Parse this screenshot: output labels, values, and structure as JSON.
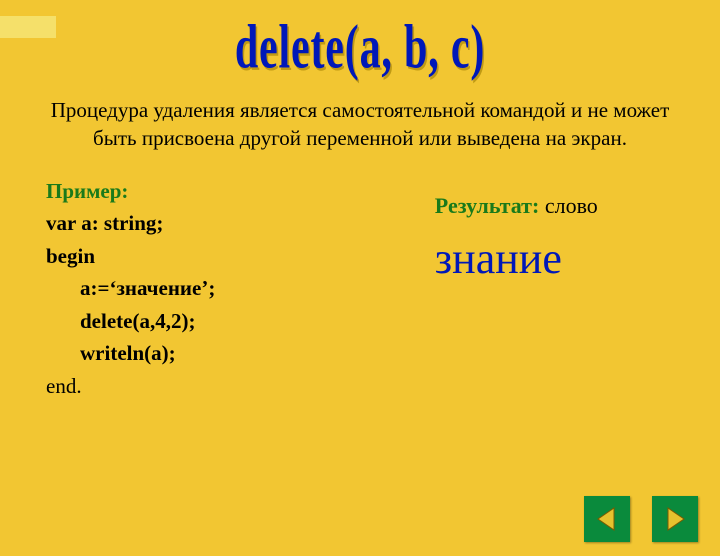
{
  "title": "delete(a, b, c)",
  "description": "Процедура удаления является самостоятельной командой и не может быть присвоена другой переменной или выведена на экран.",
  "example": {
    "header": "Пример:",
    "lines": {
      "l1": "var a: string;",
      "l2": "begin",
      "l3": "a:=‘значение’;",
      "l4": "delete(a,4,2);",
      "l5": "writeln(a);",
      "l6": "end."
    }
  },
  "result": {
    "label": "Результат:",
    "word": "слово",
    "value": "знание"
  },
  "nav": {
    "prev": "previous",
    "next": "next"
  }
}
